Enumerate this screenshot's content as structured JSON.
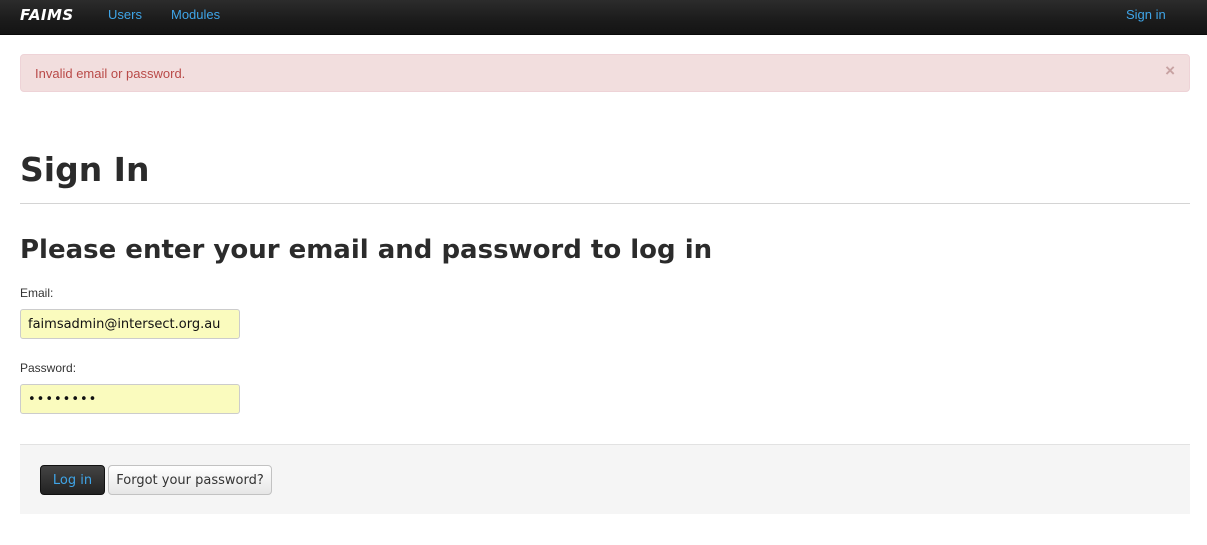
{
  "navbar": {
    "brand": "FAIMS",
    "links": [
      {
        "label": "Users"
      },
      {
        "label": "Modules"
      }
    ],
    "signin_label": "Sign in"
  },
  "alert": {
    "message": "Invalid email or password.",
    "close_glyph": "×"
  },
  "main": {
    "title": "Sign In",
    "subtitle": "Please enter your email and password to log in"
  },
  "form": {
    "email_label": "Email:",
    "email_value": "faimsadmin@intersect.org.au",
    "password_label": "Password:",
    "password_value": "••••••••",
    "login_label": "Log in",
    "forgot_label": "Forgot your password?"
  },
  "colors": {
    "navbar_bg": "#1b1b1b",
    "link_accent": "#3fa5e8",
    "alert_bg": "#f2dede",
    "alert_text": "#b94a48",
    "autofill_bg": "#fafbbe"
  }
}
